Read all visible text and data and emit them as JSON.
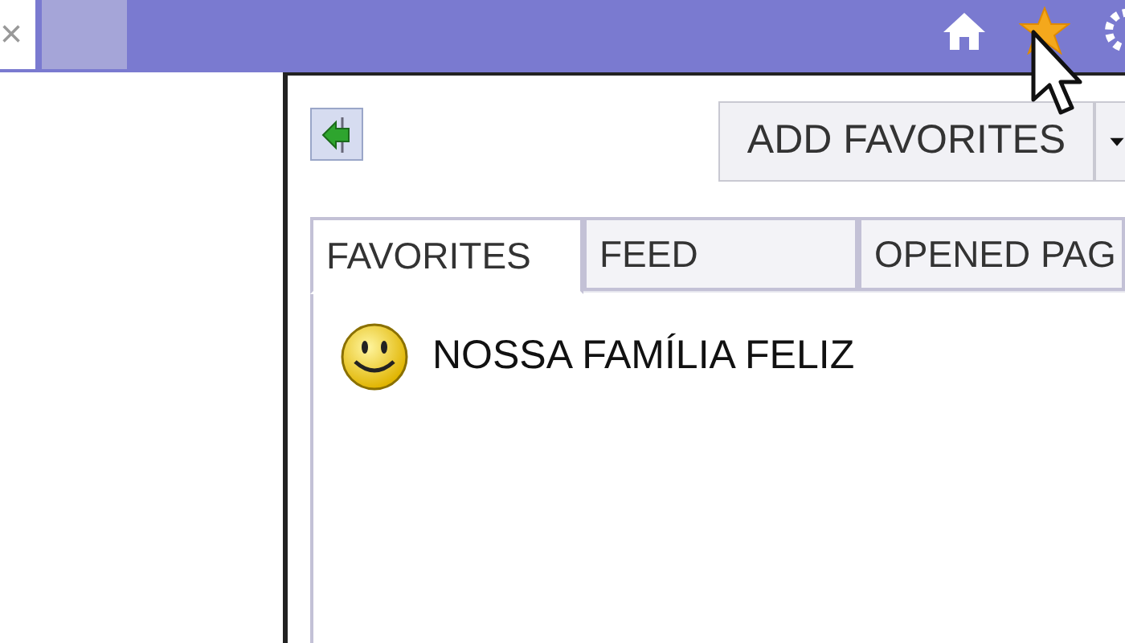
{
  "browser_tabs": [
    {
      "label": "×",
      "selected": true
    },
    {
      "selected": false
    }
  ],
  "favorites_panel": {
    "add_button": {
      "label": "ADD FAVORITES"
    },
    "tabs": [
      {
        "label": "FAVORITES",
        "selected": true
      },
      {
        "label": "FEED",
        "selected": false
      },
      {
        "label": "OPENED PAG",
        "selected": false
      }
    ],
    "items": [
      {
        "label": "NOSSA FAMÍLIA FELIZ"
      }
    ]
  }
}
